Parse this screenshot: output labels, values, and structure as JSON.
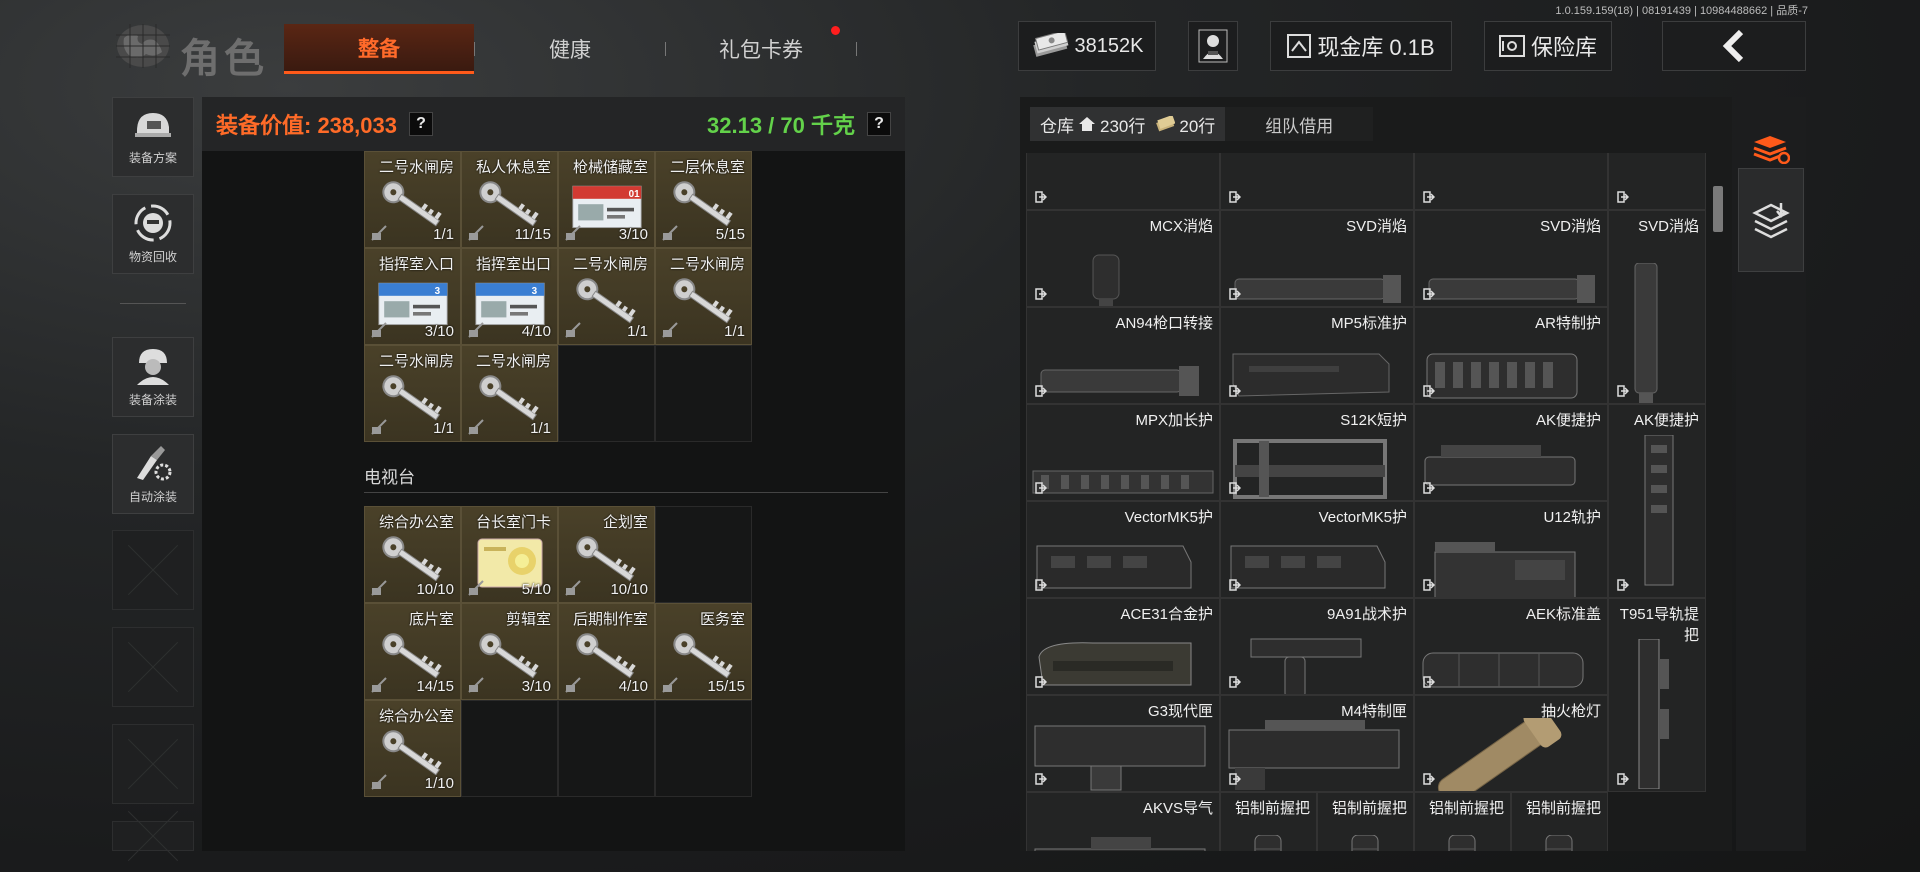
{
  "version": "1.0.159.159(18) | 08191439 | 10984488662 | 品质-7",
  "header": {
    "title": "角色",
    "tabs": [
      {
        "label": "整备",
        "active": true
      },
      {
        "label": "健康",
        "active": false
      },
      {
        "label": "礼包卡券",
        "active": false,
        "badge": true
      }
    ],
    "currency": "38152K",
    "cash_vault": "现金库 0.1B",
    "safe": "保险库"
  },
  "sidebar": [
    {
      "label": "装备方案",
      "icon": "helmet-icon"
    },
    {
      "label": "物资回收",
      "icon": "recycle-face-icon"
    },
    {
      "label": "装备涂装",
      "icon": "soldier-icon"
    },
    {
      "label": "自动涂装",
      "icon": "brush-gear-icon"
    }
  ],
  "left": {
    "value_label": "装备价值: 238,033",
    "help": "?",
    "weight": "32.13 / 70 千克",
    "keys_top": [
      {
        "name": "二号水闸房",
        "qty": "1/1",
        "art": "key"
      },
      {
        "name": "私人休息室",
        "qty": "11/15",
        "art": "key"
      },
      {
        "name": "枪械储藏室",
        "qty": "3/10",
        "art": "card-red",
        "card_no": "01"
      },
      {
        "name": "二层休息室",
        "qty": "5/15",
        "art": "key"
      },
      {
        "name": "指挥室入口",
        "qty": "3/10",
        "art": "card-blue",
        "card_no": "3"
      },
      {
        "name": "指挥室出口",
        "qty": "4/10",
        "art": "card-blue",
        "card_no": "3"
      },
      {
        "name": "二号水闸房",
        "qty": "1/1",
        "art": "key"
      },
      {
        "name": "二号水闸房",
        "qty": "1/1",
        "art": "key"
      },
      {
        "name": "二号水闸房",
        "qty": "1/1",
        "art": "key"
      },
      {
        "name": "二号水闸房",
        "qty": "1/1",
        "art": "key"
      },
      null,
      null
    ],
    "section_title": "电视台",
    "keys_tv": [
      {
        "name": "综合办公室",
        "qty": "10/10",
        "art": "key"
      },
      {
        "name": "台长室门卡",
        "qty": "5/10",
        "art": "card-yellow"
      },
      {
        "name": "企划室",
        "qty": "10/10",
        "art": "key"
      },
      null,
      {
        "name": "底片室",
        "qty": "14/15",
        "art": "key"
      },
      {
        "name": "剪辑室",
        "qty": "3/10",
        "art": "key"
      },
      {
        "name": "后期制作室",
        "qty": "4/10",
        "art": "key"
      },
      {
        "name": "医务室",
        "qty": "15/15",
        "art": "key"
      },
      {
        "name": "综合办公室",
        "qty": "1/10",
        "art": "key"
      },
      null,
      null,
      null
    ]
  },
  "warehouse": {
    "tab_label": "仓库",
    "rows_a": "230行",
    "rows_b": "20行",
    "team_tab": "组队借用",
    "items": [
      {
        "name": "",
        "art": "partial"
      },
      {
        "name": "",
        "art": "partial"
      },
      {
        "name": "",
        "art": "partial"
      },
      {
        "name": "",
        "art": "partial-badge"
      },
      {
        "name": "MCX消焰",
        "art": "suppressor-short"
      },
      {
        "name": "SVD消焰",
        "art": "suppressor"
      },
      {
        "name": "SVD消焰",
        "art": "suppressor"
      },
      {
        "name": "SVD消焰",
        "art": "suppressor-vertical"
      },
      {
        "name": "AN94枪口转接",
        "art": "muzzle"
      },
      {
        "name": "MP5标准护",
        "art": "handguard"
      },
      {
        "name": "AR特制护",
        "art": "handguard-rail"
      },
      {
        "name": "MPX加长护",
        "art": "rail-long"
      },
      {
        "name": "S12K短护",
        "art": "rail-frame"
      },
      {
        "name": "AK便捷护",
        "art": "handguard-ak"
      },
      {
        "name": "AK便捷护",
        "art": "handguard-vertical"
      },
      {
        "name": "VectorMK5护",
        "art": "vector"
      },
      {
        "name": "VectorMK5护",
        "art": "vector"
      },
      {
        "name": "U12轨护",
        "art": "u12"
      },
      {
        "name": "ACE31合金护",
        "art": "ace"
      },
      {
        "name": "9A91战术护",
        "art": "grip-rail"
      },
      {
        "name": "AEK标准盖",
        "art": "cover"
      },
      {
        "name": "T951导轨提把",
        "art": "carry-handle"
      },
      {
        "name": "G3现代匣",
        "art": "g3"
      },
      {
        "name": "M4特制匣",
        "art": "m4"
      },
      {
        "name": "抽火枪灯",
        "art": "flashlight"
      },
      {
        "name": "AKVS导气",
        "art": "gas-tube"
      },
      {
        "name": "铝制前握把",
        "art": "grip"
      },
      {
        "name": "铝制前握把",
        "art": "grip"
      },
      {
        "name": "铝制前握把",
        "art": "grip"
      },
      {
        "name": "铝制前握把",
        "art": "grip"
      }
    ]
  },
  "colors": {
    "accent": "#ff6b28",
    "weight_green": "#63d24a",
    "key_cell_bg": "#4a4129",
    "badge_red": "#ff1e1e"
  }
}
